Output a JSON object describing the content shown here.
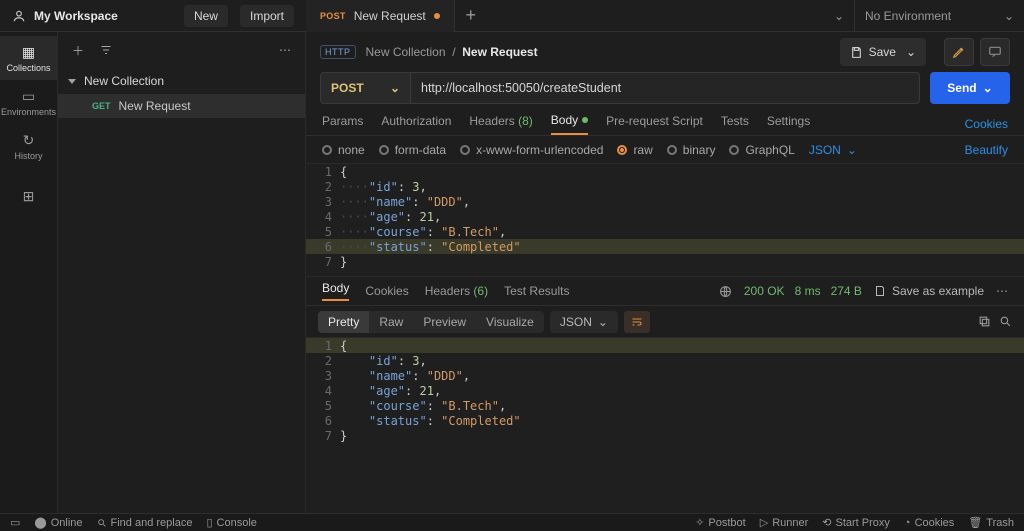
{
  "workspace": {
    "name": "My Workspace"
  },
  "topbar": {
    "new": "New",
    "import": "Import"
  },
  "tab": {
    "method": "POST",
    "title": "New Request",
    "dirty": true
  },
  "env": {
    "label": "No Environment"
  },
  "rail": {
    "collections": "Collections",
    "environments": "Environments",
    "history": "History"
  },
  "sidebar": {
    "collection": "New Collection",
    "request_method": "GET",
    "request_name": "New Request"
  },
  "breadcrumb": {
    "collection": "New Collection",
    "request": "New Request"
  },
  "save": {
    "label": "Save"
  },
  "request": {
    "method": "POST",
    "url": "http://localhost:50050/createStudent",
    "send": "Send"
  },
  "reqTabs": {
    "params": "Params",
    "auth": "Authorization",
    "headers": "Headers",
    "headers_count": "(8)",
    "body": "Body",
    "prereq": "Pre-request Script",
    "tests": "Tests",
    "settings": "Settings",
    "cookies": "Cookies"
  },
  "bodyTypes": {
    "none": "none",
    "form": "form-data",
    "urlenc": "x-www-form-urlencoded",
    "raw": "raw",
    "binary": "binary",
    "graphql": "GraphQL",
    "json": "JSON",
    "beautify": "Beautify"
  },
  "reqBody": {
    "l1": "{",
    "l2_k": "\"id\"",
    "l2_v": "3",
    "l3_k": "\"name\"",
    "l3_v": "\"DDD\"",
    "l4_k": "\"age\"",
    "l4_v": "21",
    "l5_k": "\"course\"",
    "l5_v": "\"B.Tech\"",
    "l6_k": "\"status\"",
    "l6_v": "\"Completed\"",
    "l7": "}"
  },
  "respTabs": {
    "body": "Body",
    "cookies": "Cookies",
    "headers": "Headers",
    "headers_count": "(6)",
    "test": "Test Results",
    "status": "200 OK",
    "time": "8 ms",
    "size": "274 B",
    "save_ex": "Save as example"
  },
  "respView": {
    "pretty": "Pretty",
    "raw": "Raw",
    "preview": "Preview",
    "visualize": "Visualize",
    "json": "JSON"
  },
  "respBody": {
    "l1": "{",
    "l2_k": "\"id\"",
    "l2_v": "3",
    "l3_k": "\"name\"",
    "l3_v": "\"DDD\"",
    "l4_k": "\"age\"",
    "l4_v": "21",
    "l5_k": "\"course\"",
    "l5_v": "\"B.Tech\"",
    "l6_k": "\"status\"",
    "l6_v": "\"Completed\"",
    "l7": "}"
  },
  "status": {
    "online": "Online",
    "find": "Find and replace",
    "console": "Console",
    "postbot": "Postbot",
    "runner": "Runner",
    "proxy": "Start Proxy",
    "cookies": "Cookies",
    "trash": "Trash"
  }
}
